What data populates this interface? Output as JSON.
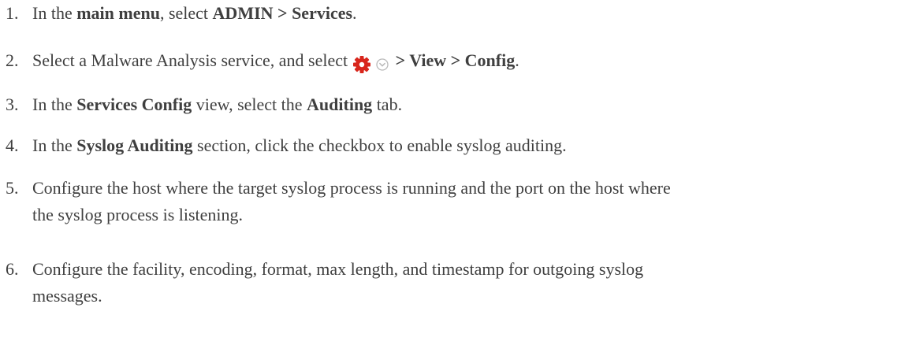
{
  "steps": [
    {
      "number": "1.",
      "pre": "In the ",
      "b1": "main menu",
      "mid": ", select ",
      "b2": "ADMIN > Services",
      "post": "."
    },
    {
      "number": "2.",
      "pre": "Select a Malware Analysis service, and select ",
      "b1": " > View > Config",
      "post": ".",
      "icons": [
        "gear-icon",
        "chevron-down-circle-icon"
      ],
      "colors": {
        "gear": "#d8261c",
        "chevron": "#b9b9b9"
      }
    },
    {
      "number": "3.",
      "pre": "In the ",
      "b1": "Services Config",
      "mid": " view, select the ",
      "b2": "Auditing",
      "post": " tab."
    },
    {
      "number": "4.",
      "pre": "In the ",
      "b1": "Syslog Auditing",
      "post": " section, click the checkbox to enable syslog auditing."
    },
    {
      "number": "5.",
      "line1": "Configure the host where the target syslog process is running and the port on the host where",
      "line2": "the syslog process is listening."
    },
    {
      "number": "6.",
      "line1": "Configure the facility, encoding, format, max length, and timestamp for outgoing syslog",
      "line2": "messages."
    }
  ]
}
